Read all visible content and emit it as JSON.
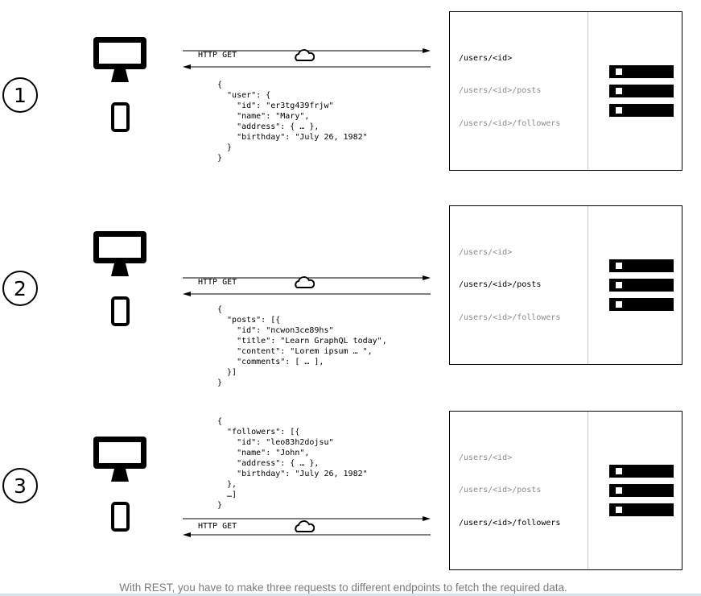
{
  "steps": [
    {
      "number": "1",
      "request_label": "HTTP GET",
      "response_json": "{\n  \"user\": {\n    \"id\": \"er3tg439frjw\"\n    \"name\": \"Mary\",\n    \"address\": { … },\n    \"birthday\": \"July 26, 1982\"\n  }\n}",
      "endpoints": [
        {
          "label": "/users/<id>",
          "active": true
        },
        {
          "label": "/users/<id>/posts",
          "active": false
        },
        {
          "label": "/users/<id>/followers",
          "active": false
        }
      ]
    },
    {
      "number": "2",
      "request_label": "HTTP GET",
      "response_json": "{\n  \"posts\": [{\n    \"id\": \"ncwon3ce89hs\"\n    \"title\": \"Learn GraphQL today\",\n    \"content\": \"Lorem ipsum … \",\n    \"comments\": [ … ],\n  }]\n}",
      "endpoints": [
        {
          "label": "/users/<id>",
          "active": false
        },
        {
          "label": "/users/<id>/posts",
          "active": true
        },
        {
          "label": "/users/<id>/followers",
          "active": false
        }
      ]
    },
    {
      "number": "3",
      "request_label": "HTTP GET",
      "response_json": "{\n  \"followers\": [{\n    \"id\": \"leo83h2dojsu\"\n    \"name\": \"John\",\n    \"address\": { … },\n    \"birthday\": \"July 26, 1982\"\n  },\n  …]\n}",
      "endpoints": [
        {
          "label": "/users/<id>",
          "active": false
        },
        {
          "label": "/users/<id>/posts",
          "active": false
        },
        {
          "label": "/users/<id>/followers",
          "active": true
        }
      ]
    }
  ],
  "caption": "With REST, you have to make three requests to different endpoints to fetch the required data.",
  "colors": {
    "line": "#000000",
    "inactive_text": "#8a8a8a",
    "divider": "#c8c8c8",
    "caption": "#7a7a7a"
  }
}
